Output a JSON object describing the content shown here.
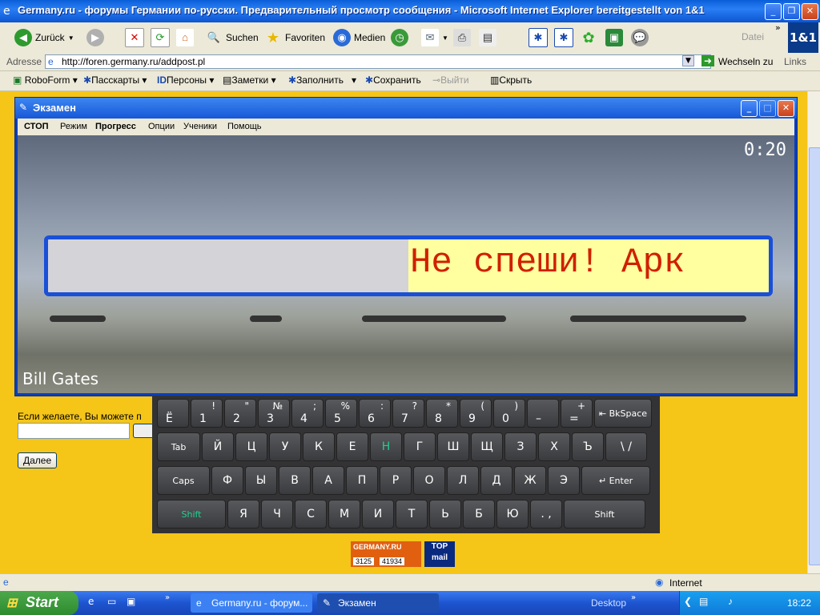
{
  "ie": {
    "title": "Germany.ru - форумы Германии по-русски. Предварительный просмотр сообщения - Microsoft Internet Explorer bereitgestellt von 1&1",
    "back": "Zurück",
    "search": "Suchen",
    "favorites": "Favoriten",
    "media": "Medien",
    "datei": "Datei",
    "logo": "1&1",
    "address_label": "Adresse",
    "url": "http://foren.germany.ru/addpost.pl",
    "go": "Wechseln zu",
    "links": "Links"
  },
  "roboform": [
    "RoboForm",
    "Пасскарты",
    "Персоны",
    "Заметки",
    "Заполнить",
    "Сохранить",
    "Выйти",
    "Скрыть"
  ],
  "page": {
    "hint": "Если желаете, Вы можете п",
    "next_button": "Далее",
    "counter1": "3125",
    "counter2": "41934",
    "logo1": "GERMANY.RU",
    "logo2": "TOP mail"
  },
  "exam": {
    "title": "Экзамен",
    "menu": [
      "СТОП",
      "Режим",
      "Прогресс",
      "Опции",
      "Ученики",
      "Помощь"
    ],
    "timer": "0:20",
    "text": "Не спеши! Арк",
    "author": "Bill Gates"
  },
  "keyboard": {
    "row1": [
      {
        "b": "Ё",
        "t": ""
      },
      {
        "b": "1",
        "t": "!"
      },
      {
        "b": "2",
        "t": "\""
      },
      {
        "b": "3",
        "t": "№"
      },
      {
        "b": "4",
        "t": ";"
      },
      {
        "b": "5",
        "t": "%"
      },
      {
        "b": "6",
        "t": ":"
      },
      {
        "b": "7",
        "t": "?"
      },
      {
        "b": "8",
        "t": "*"
      },
      {
        "b": "9",
        "t": "("
      },
      {
        "b": "0",
        "t": ")"
      },
      {
        "b": "–",
        "t": ""
      },
      {
        "b": "=",
        "t": "+"
      }
    ],
    "bkspace": "BkSpace",
    "tab": "Tab",
    "row2": [
      "Й",
      "Ц",
      "У",
      "К",
      "Е",
      "Н",
      "Г",
      "Ш",
      "Щ",
      "З",
      "Х",
      "Ъ",
      "\\ /"
    ],
    "caps": "Caps",
    "row3": [
      "Ф",
      "Ы",
      "В",
      "А",
      "П",
      "Р",
      "О",
      "Л",
      "Д",
      "Ж",
      "Э"
    ],
    "enter": "Enter",
    "shift": "Shift",
    "row4": [
      "Я",
      "Ч",
      "С",
      "М",
      "И",
      "Т",
      "Ь",
      "Б",
      "Ю",
      ". ,"
    ],
    "highlight_color": "#20d090"
  },
  "status": {
    "zone": "Internet"
  },
  "taskbar": {
    "start": "Start",
    "tasks": [
      "Germany.ru - форум...",
      "Экзамен"
    ],
    "desktop": "Desktop",
    "clock": "18:22"
  }
}
